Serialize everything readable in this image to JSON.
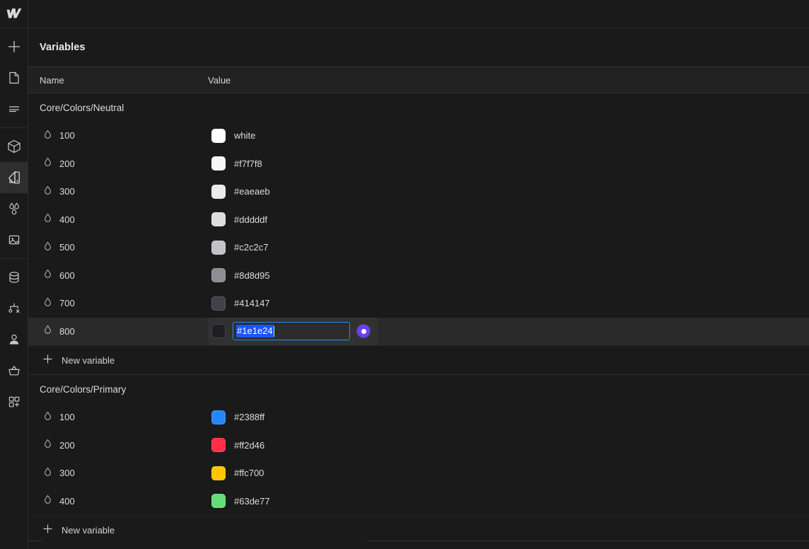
{
  "app": {
    "logo": "webflow-logo"
  },
  "rail": {
    "groups": [
      {
        "items": [
          {
            "name": "add-element",
            "icon": "plus-icon",
            "active": false
          },
          {
            "name": "pages",
            "icon": "page-icon",
            "active": false
          },
          {
            "name": "navigator",
            "icon": "list-icon",
            "active": false
          }
        ]
      },
      {
        "items": [
          {
            "name": "components",
            "icon": "cube-icon",
            "active": false
          },
          {
            "name": "style-variables",
            "icon": "swatch-icon",
            "active": true
          },
          {
            "name": "assets-colors",
            "icon": "droplets-icon",
            "active": false
          },
          {
            "name": "assets",
            "icon": "image-icon",
            "active": false
          }
        ]
      },
      {
        "items": [
          {
            "name": "cms",
            "icon": "database-icon",
            "active": false
          },
          {
            "name": "logic",
            "icon": "logic-icon",
            "active": false
          },
          {
            "name": "users",
            "icon": "user-icon",
            "active": false
          },
          {
            "name": "ecommerce",
            "icon": "basket-icon",
            "active": false
          },
          {
            "name": "apps",
            "icon": "apps-plus-icon",
            "active": false
          }
        ]
      }
    ]
  },
  "panel": {
    "title": "Variables",
    "columns": {
      "name": "Name",
      "value": "Value"
    },
    "new_variable_label": "New variable",
    "groups": [
      {
        "title": "Core/Colors/Neutral",
        "rows": [
          {
            "name": "100",
            "value": "white",
            "swatch": "#ffffff",
            "editing": false
          },
          {
            "name": "200",
            "value": "#f7f7f8",
            "swatch": "#f7f7f8",
            "editing": false
          },
          {
            "name": "300",
            "value": "#eaeaeb",
            "swatch": "#eaeaeb",
            "editing": false
          },
          {
            "name": "400",
            "value": "#dddddf",
            "swatch": "#dddddf",
            "editing": false
          },
          {
            "name": "500",
            "value": "#c2c2c7",
            "swatch": "#c2c2c7",
            "editing": false
          },
          {
            "name": "600",
            "value": "#8d8d95",
            "swatch": "#8d8d95",
            "editing": false
          },
          {
            "name": "700",
            "value": "#414147",
            "swatch": "#414147",
            "editing": false
          },
          {
            "name": "800",
            "value": "#1e1e24",
            "swatch": "#1e1e24",
            "editing": true
          }
        ]
      },
      {
        "title": "Core/Colors/Primary",
        "rows": [
          {
            "name": "100",
            "value": "#2388ff",
            "swatch": "#2388ff",
            "editing": false
          },
          {
            "name": "200",
            "value": "#ff2d46",
            "swatch": "#ff2d46",
            "editing": false
          },
          {
            "name": "300",
            "value": "#ffc700",
            "swatch": "#ffc700",
            "editing": false
          },
          {
            "name": "400",
            "value": "#63de77",
            "swatch": "#63de77",
            "editing": false
          }
        ]
      }
    ],
    "editing_field": {
      "value": "#1e1e24",
      "selected": true,
      "mode_indicator": "variable-mode-dot",
      "accent": "#2b8aee",
      "selection_color": "#1a54ff",
      "mode_color": "#6f3ef0"
    }
  }
}
